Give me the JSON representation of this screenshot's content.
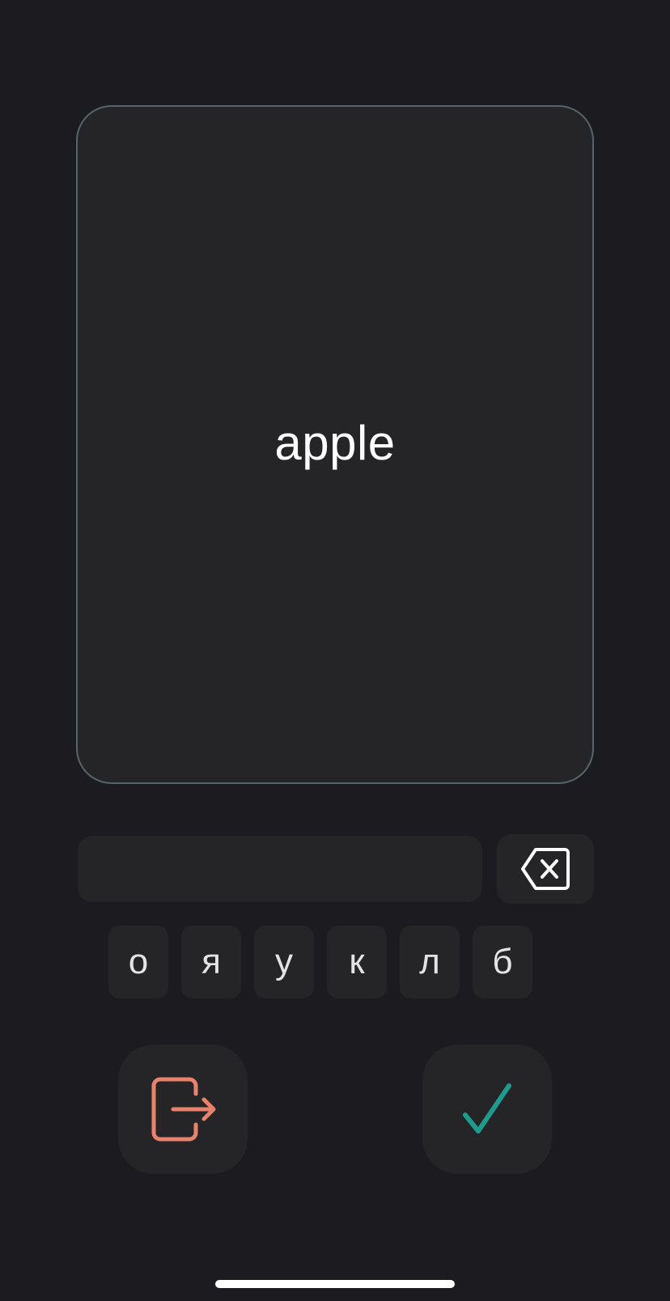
{
  "card": {
    "word": "apple"
  },
  "answer": {
    "value": ""
  },
  "letters": [
    "о",
    "я",
    "у",
    "к",
    "л",
    "б"
  ],
  "colors": {
    "background": "#1c1c20",
    "surface": "#252528",
    "card_border": "#55656a",
    "exit_accent": "#e8826c",
    "check_accent": "#1f9a8e"
  },
  "icons": {
    "backspace": "backspace-icon",
    "exit": "exit-icon",
    "check": "checkmark-icon"
  }
}
